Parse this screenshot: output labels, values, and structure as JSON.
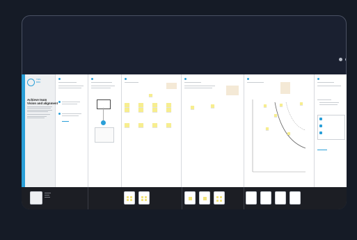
{
  "board": {
    "intro_title": "Achieve team\nVision and alignment",
    "logo_text": "TMS\nBRD"
  },
  "menu": {
    "more_label": "More options"
  },
  "colors": {
    "accent": "#2a9fd8",
    "sticky": "#f7ee8f",
    "background": "#151b26"
  }
}
